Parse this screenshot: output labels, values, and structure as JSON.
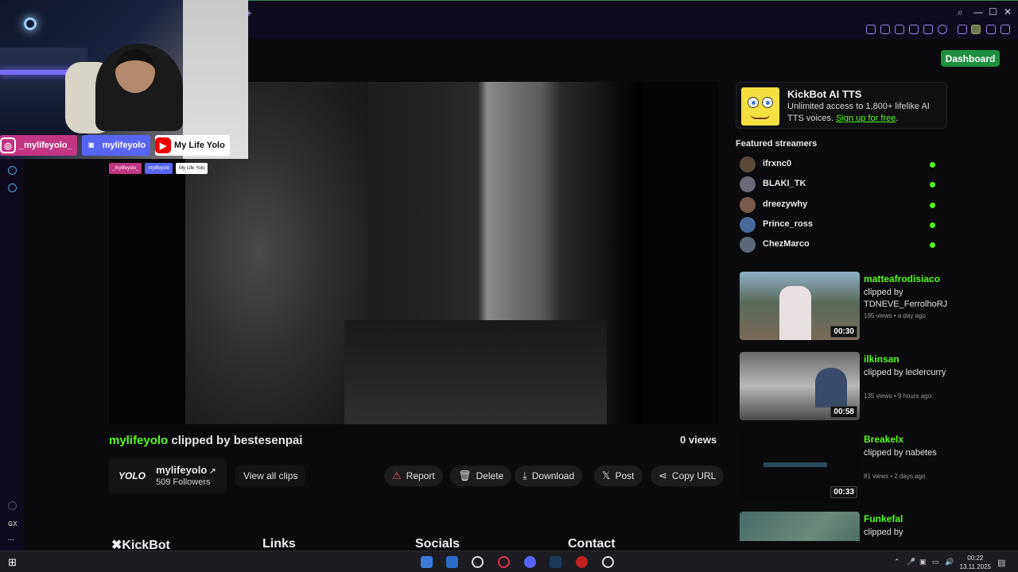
{
  "browser": {
    "new_tab_glyph": "+",
    "window_controls": [
      "⌕",
      "—",
      "☐",
      "✕"
    ]
  },
  "sidebar": {
    "gx_label": "GX",
    "more_label": "···"
  },
  "header": {
    "dashboard_label": "Dashboard"
  },
  "webcam_overlay": {
    "instagram_handle": "_mylifeyolo_",
    "discord_handle": "mylifeyolo",
    "youtube_channel": "My Life Yolo"
  },
  "clip": {
    "channel": "mylifeyolo",
    "clipped_by_text": " clipped by bestesenpai",
    "views": "0 views"
  },
  "channel_card": {
    "avatar_text": "YOLO",
    "name": "mylifeyolo",
    "followers": "509 Followers",
    "view_all_label": "View all clips"
  },
  "actions": {
    "report": "Report",
    "delete": "Delete",
    "download": "Download",
    "post": "Post",
    "copy_url": "Copy URL"
  },
  "footer": {
    "brand": "✖KickBot",
    "links": "Links",
    "socials": "Socials",
    "contact": "Contact"
  },
  "ad": {
    "title": "KickBot AI TTS",
    "text": "Unlimited access to 1,800+ lifelike AI TTS voices. ",
    "link": "Sign up for free",
    "suffix": "."
  },
  "featured": {
    "title": "Featured streamers",
    "streamers": [
      "ifrxnc0",
      "BLAKI_TK",
      "dreezywhy",
      "Prince_ross",
      "ChezMarco"
    ]
  },
  "clips": [
    {
      "channel": "matteafrodisiaco",
      "by": "clipped by TDNEVE_FerrolhoRJ",
      "meta": "195 views • a day ago",
      "duration": "00:30"
    },
    {
      "channel": "ilkinsan",
      "by": "clipped by leclercurry",
      "meta": "135 views • 9 hours ago",
      "duration": "00:58"
    },
    {
      "channel": "Breakelx",
      "by": "clipped by nabetes",
      "meta": "81 views • 2 days ago",
      "duration": "00:33"
    },
    {
      "channel": "Funkefal",
      "by": "clipped by",
      "meta": "",
      "duration": ""
    }
  ],
  "taskbar": {
    "time": "00:22",
    "date": "13.11.2025"
  },
  "colors": {
    "accent": "#53fc18",
    "dashboard": "#1e8f3e"
  }
}
